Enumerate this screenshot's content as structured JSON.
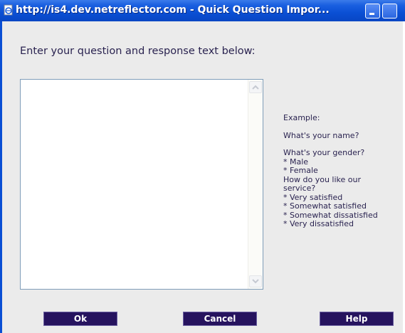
{
  "window": {
    "title": "http://is4.dev.netreflector.com - Quick Question Impor..."
  },
  "dialog": {
    "instruction": "Enter your question and response text below:",
    "textarea_value": ""
  },
  "example": {
    "heading": "Example:",
    "lines_a": [
      "What's your name?"
    ],
    "lines_b": [
      "What's your gender?",
      "* Male",
      "* Female",
      "How do you like our",
      "service?",
      "* Very satisfied",
      "* Somewhat satisfied",
      "* Somewhat dissatisfied",
      "* Very dissatisfied"
    ]
  },
  "buttons": {
    "ok": "Ok",
    "cancel": "Cancel",
    "help": "Help"
  },
  "colors": {
    "titlebar": "#0a4fd4",
    "button_bg": "#26135e",
    "text": "#2a2350",
    "panel_bg": "#ebebeb"
  },
  "icons": {
    "window": "ie-page-icon",
    "minimize": "minimize-icon",
    "maximize": "maximize-icon",
    "scroll_up": "arrow-up-icon",
    "scroll_down": "arrow-down-icon"
  }
}
